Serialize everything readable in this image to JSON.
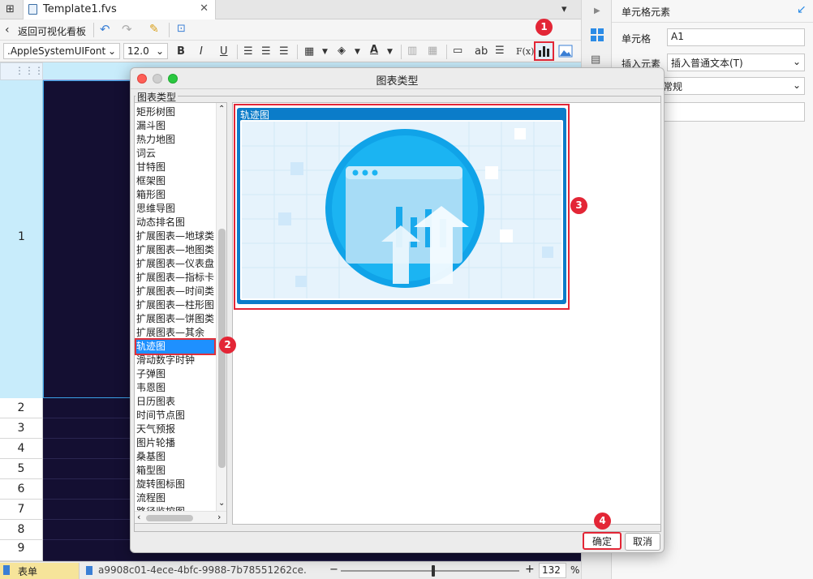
{
  "tabs": {
    "active_label": "Template1.fvs"
  },
  "toolbar": {
    "back_label": "返回可视化看板",
    "font_name": ".AppleSystemUIFont",
    "font_size": "12.0",
    "bold": "B",
    "italic": "I",
    "underline": "U",
    "text_ab": "ab",
    "formula": "F(x)"
  },
  "grid": {
    "row_labels": [
      "1",
      "2",
      "3",
      "4",
      "5",
      "6",
      "7",
      "8",
      "9"
    ]
  },
  "status": {
    "sheet_tab": "表单",
    "template_id": "a9908c01-4ece-4bfc-9988-7b78551262ce.",
    "zoom_minus": "−",
    "zoom_plus": "+",
    "zoom": "132",
    "zoom_unit": "%"
  },
  "right_panel": {
    "title": "单元格元素",
    "cell_label": "单元格",
    "cell_value": "A1",
    "insert_label": "插入元素",
    "insert_value": "插入普通文本(T)",
    "format_value": "常规"
  },
  "dialog": {
    "title": "图表类型",
    "group_label": "图表类型",
    "chart_types": [
      "矩形树图",
      "漏斗图",
      "热力地图",
      "词云",
      "甘特图",
      "框架图",
      "箱形图",
      "思维导图",
      "动态排名图",
      "扩展图表—地球类",
      "扩展图表—地图类",
      "扩展图表—仪表盘",
      "扩展图表—指标卡",
      "扩展图表—时间类",
      "扩展图表—柱形图",
      "扩展图表—饼图类",
      "扩展图表—其余",
      "轨迹图",
      "滑动数字时钟",
      "子弹图",
      "韦恩图",
      "日历图表",
      "时间节点图",
      "天气预报",
      "图片轮播",
      "桑基图",
      "箱型图",
      "旋转图标图",
      "流程图",
      "路径监控图"
    ],
    "selected_index": 17,
    "preview_title": "轨迹图",
    "ok_label": "确定",
    "cancel_label": "取消"
  },
  "badges": [
    "1",
    "2",
    "3",
    "4"
  ],
  "colors": {
    "accent": "#1e90ff",
    "annotation": "#e32636",
    "cell_bg": "#140f32",
    "header_bg": "#c8ecfb"
  }
}
